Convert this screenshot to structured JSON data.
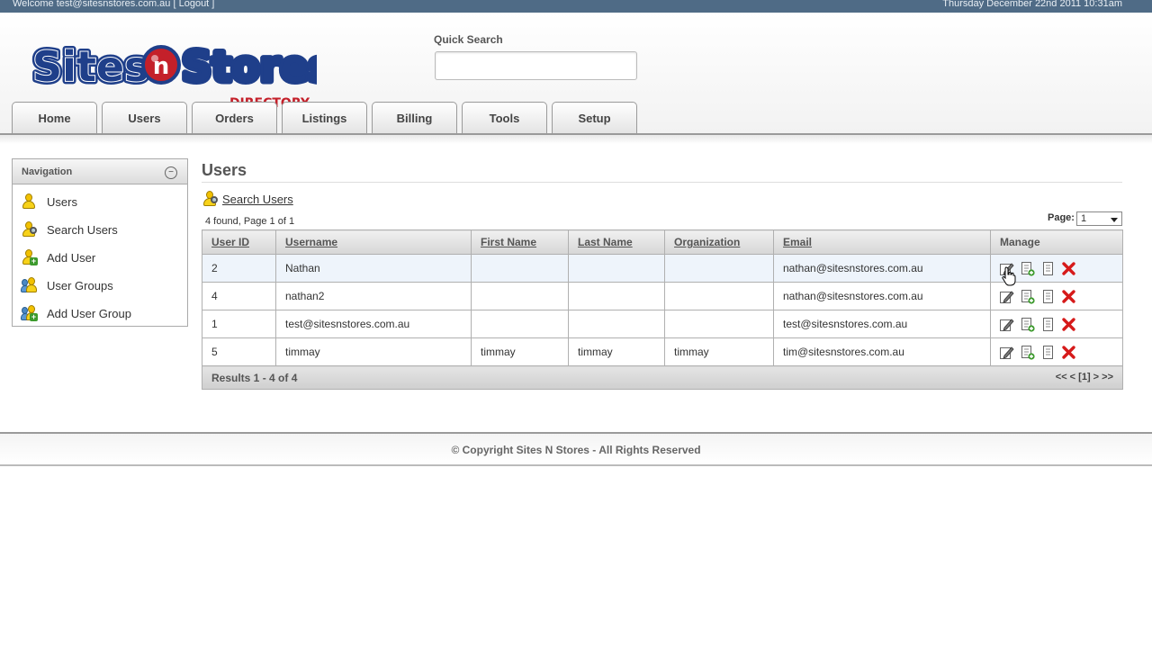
{
  "topbar": {
    "welcome_text": "Welcome test@sitesnstores.com.au",
    "logout_label": "[ Logout ]",
    "date": "Thursday December 22nd 2011 10:31am"
  },
  "logo": {
    "text": "Sites N Stores",
    "subtitle": "DIRECTORY"
  },
  "quick_search": {
    "label": "Quick Search",
    "value": ""
  },
  "tabs": [
    {
      "label": "Home"
    },
    {
      "label": "Users"
    },
    {
      "label": "Orders"
    },
    {
      "label": "Listings"
    },
    {
      "label": "Billing"
    },
    {
      "label": "Tools"
    },
    {
      "label": "Setup"
    }
  ],
  "navigation": {
    "title": "Navigation",
    "items": [
      {
        "label": "Users",
        "icon": "user-icon"
      },
      {
        "label": "Search Users",
        "icon": "search-user-icon"
      },
      {
        "label": "Add User",
        "icon": "add-user-icon"
      },
      {
        "label": "User Groups",
        "icon": "user-group-icon"
      },
      {
        "label": "Add User Group",
        "icon": "add-user-group-icon"
      }
    ]
  },
  "main": {
    "title": "Users",
    "search_link": "Search Users",
    "found_text": "4 found, Page 1 of 1",
    "page_label": "Page:",
    "page_value": "1"
  },
  "table": {
    "columns": [
      "User ID",
      "Username",
      "First Name",
      "Last Name",
      "Organization",
      "Email",
      "Manage"
    ],
    "rows": [
      {
        "id": "2",
        "username": "Nathan",
        "first": "",
        "last": "",
        "org": "",
        "email": "nathan@sitesnstores.com.au"
      },
      {
        "id": "4",
        "username": "nathan2",
        "first": "",
        "last": "",
        "org": "",
        "email": "nathan@sitesnstores.com.au"
      },
      {
        "id": "1",
        "username": "test@sitesnstores.com.au",
        "first": "",
        "last": "",
        "org": "",
        "email": "test@sitesnstores.com.au"
      },
      {
        "id": "5",
        "username": "timmay",
        "first": "timmay",
        "last": "timmay",
        "org": "timmay",
        "email": "tim@sitesnstores.com.au"
      }
    ],
    "footer_results": "Results 1 - 4 of 4",
    "pager": "<< < [1] > >>"
  },
  "footer": {
    "copyright": "© Copyright Sites N Stores - All Rights Reserved"
  },
  "colors": {
    "topbar": "#4f6b86",
    "logo_blue": "#1f3f8a",
    "logo_red": "#c4202a",
    "delete_red": "#d61a1a"
  }
}
